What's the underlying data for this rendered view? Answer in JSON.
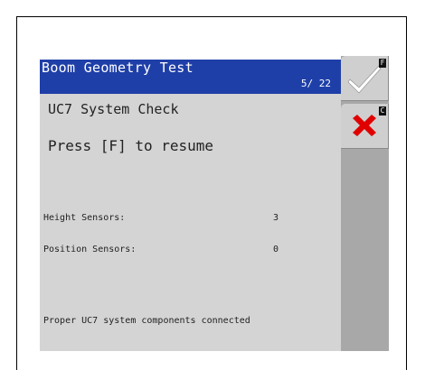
{
  "header": {
    "title": "Boom Geometry Test",
    "page": "5/ 22"
  },
  "main": {
    "subtitle": "UC7 System Check",
    "instruction": "Press [F] to resume",
    "rows": [
      {
        "label": "Height Sensors:",
        "value": "3"
      },
      {
        "label": "Position Sensors:",
        "value": "0"
      }
    ],
    "footer": "Proper UC7 system components connected"
  },
  "softkeys": {
    "confirm": {
      "icon": "checkmark-icon",
      "key": "F",
      "color": "#ffffff"
    },
    "cancel": {
      "icon": "x-icon",
      "key": "C",
      "color": "#e00000"
    }
  },
  "colors": {
    "header_bg": "#1f3fa8",
    "screen_bg": "#d4d4d4",
    "sidebar_bg": "#a8a8a8"
  }
}
